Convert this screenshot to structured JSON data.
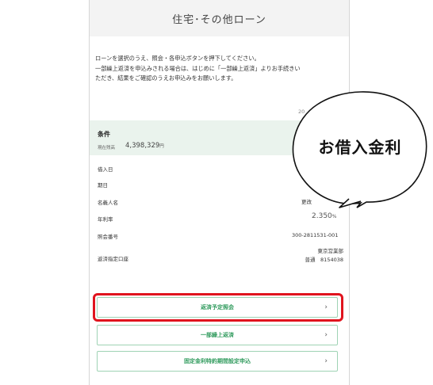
{
  "header": {
    "title": "住宅･その他ローン"
  },
  "intro": {
    "line1": "ローンを選択のうえ、照会・各申込ボタンを押下してください。",
    "line2": "一部繰上返済を申込みされる場合は、はじめに「一部繰上返済」よりお手続きい",
    "line3": "ただき、結果をご確認のうえお申込みをお願いします。"
  },
  "date_partial": "20",
  "conditions": {
    "title": "条件",
    "balance_label": "現在残高",
    "balance_value": "4,398,329",
    "balance_unit": "円"
  },
  "details": {
    "borrow_date_label": "借入日",
    "due_date_label": "期日",
    "holder_label": "名義人名",
    "holder_value_partial": "更改",
    "rate_label": "年利率",
    "rate_value": "2.350",
    "rate_unit": "%",
    "inquiry_no_label": "照会番号",
    "inquiry_no_value": "300-2811531-001",
    "account_label": "返済指定口座",
    "account_branch": "東京営業部",
    "account_number": "普通　8154038"
  },
  "buttons": {
    "schedule": "返済予定照会",
    "partial_prepay": "一部繰上返済",
    "fixed_rate": "固定金利特約期間設定申込",
    "chevron": "›"
  },
  "callout": {
    "text": "お借入金利"
  },
  "colors": {
    "accent_green": "#2f9a5c",
    "highlight_red": "#e0141e",
    "section_bg": "#eaf3ed"
  }
}
